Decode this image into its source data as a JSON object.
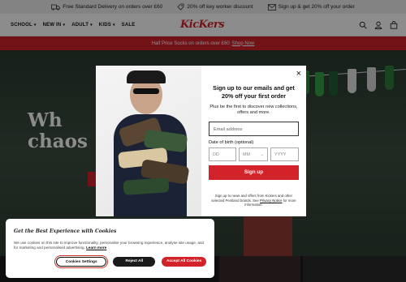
{
  "promo": {
    "items": [
      {
        "icon": "truck-icon",
        "text": "Free Standard Delivery on orders over £60"
      },
      {
        "icon": "percent-icon",
        "text": "20% off key worker discount"
      },
      {
        "icon": "mail-icon",
        "text": "Sign up & get 20% off your order"
      }
    ]
  },
  "nav": {
    "items": [
      {
        "label": "SCHOOL",
        "dropdown": true
      },
      {
        "label": "NEW IN",
        "dropdown": true
      },
      {
        "label": "ADULT",
        "dropdown": true
      },
      {
        "label": "KIDS",
        "dropdown": true
      },
      {
        "label": "SALE",
        "dropdown": false
      }
    ],
    "logo": "KicKers",
    "icons": [
      "search-icon",
      "user-icon",
      "bag-icon"
    ]
  },
  "banner": {
    "text": "Half Price Socks on orders over £60",
    "link": "Shop Now"
  },
  "hero": {
    "title_line1": "Wh",
    "title_line2": "chaos"
  },
  "modal": {
    "close_icon": "×",
    "title": "Sign up to our emails and get 20% off your first order",
    "subtitle": "Plus be the first to discover new collections, offers and more.",
    "email_placeholder": "Email address",
    "dob_label": "Date of birth (optional)",
    "dob_day": "DD",
    "dob_month": "MM",
    "dob_year": "YYYY",
    "signup_label": "Sign up",
    "terms_text": "Sign up to news and offers from Kickers and other selected Pentland brands. See",
    "terms_link": "Privacy Notice",
    "terms_tail": "for more information."
  },
  "cookie": {
    "title": "Get the Best Experience with Cookies",
    "text": "We use cookies on this site to improve functionality, personalise your browsing experience, analyse site usage, and for marketing and personalised advertising.",
    "learn_more": "Learn more",
    "settings_label": "Cookies Settings",
    "reject_label": "Reject All",
    "accept_label": "Accept All Cookies"
  },
  "colors": {
    "brand_red": "#d2232a",
    "promo_bg": "#efefef"
  }
}
